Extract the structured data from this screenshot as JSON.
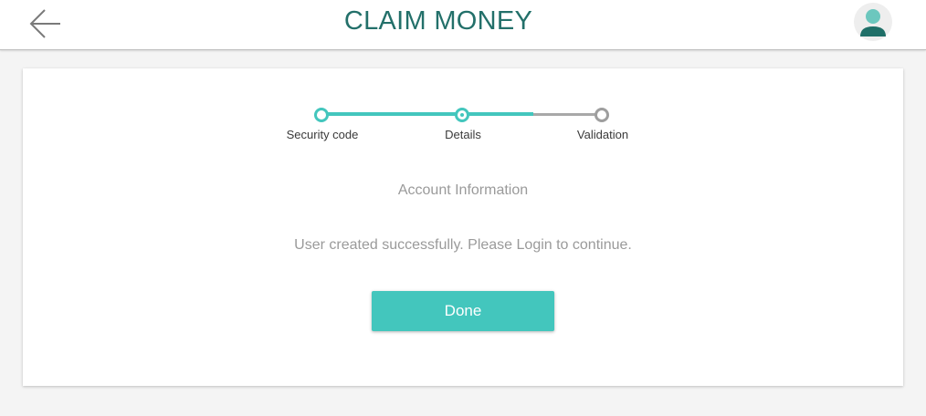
{
  "header": {
    "title": "CLAIM MONEY",
    "back_icon": "arrow-left-icon",
    "avatar_icon": "user-avatar-icon"
  },
  "stepper": {
    "steps": [
      {
        "label": "Security code",
        "state": "completed"
      },
      {
        "label": "Details",
        "state": "current"
      },
      {
        "label": "Validation",
        "state": "pending"
      }
    ]
  },
  "content": {
    "section_title": "Account Information",
    "message": "User created successfully. Please Login to continue.",
    "done_label": "Done"
  },
  "colors": {
    "accent": "#43c6bd",
    "title": "#23706a",
    "pending": "#9e9e9e",
    "avatar_head": "#6cc7be",
    "avatar_body": "#1f6f68"
  }
}
